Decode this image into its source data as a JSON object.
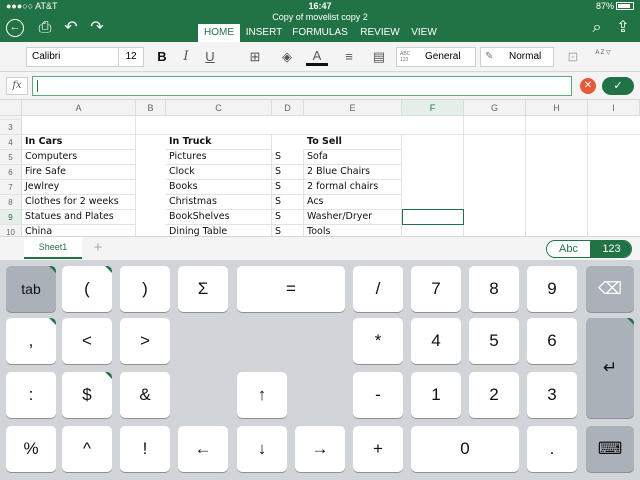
{
  "status": {
    "carrier": "●●●○○ AT&T",
    "time": "16:47",
    "battery": "87%"
  },
  "title": "Copy of movelist copy 2",
  "ribbon_tabs": [
    "HOME",
    "INSERT",
    "FORMULAS",
    "REVIEW",
    "VIEW"
  ],
  "toolbar": {
    "font": "Calibri",
    "size": "12",
    "bold": "B",
    "italic": "I",
    "underline": "U",
    "number_format": "General",
    "cell_style": "Normal",
    "number_format_icon": "ABC 123",
    "sort_icon": "A Z"
  },
  "formula": {
    "fx": "fx",
    "value": ""
  },
  "columns": [
    "A",
    "B",
    "C",
    "D",
    "E",
    "F",
    "G",
    "H",
    "I"
  ],
  "rows": [
    {
      "num": "3",
      "cells": [
        "",
        "",
        "",
        "",
        ""
      ]
    },
    {
      "num": "4",
      "cells": [
        "In Cars",
        "In Truck",
        "",
        "To Sell",
        ""
      ]
    },
    {
      "num": "5",
      "cells": [
        "Computers",
        "Pictures",
        "S",
        "Sofa",
        ""
      ]
    },
    {
      "num": "6",
      "cells": [
        "Fire Safe",
        "Clock",
        "S",
        "2 Blue Chairs",
        ""
      ]
    },
    {
      "num": "7",
      "cells": [
        "Jewlrey",
        "Books",
        "S",
        "2 formal chairs",
        ""
      ]
    },
    {
      "num": "8",
      "cells": [
        "Clothes for 2 weeks",
        "Christmas",
        "S",
        "Acs",
        ""
      ]
    },
    {
      "num": "9",
      "cells": [
        "Statues and Plates",
        "BookShelves",
        "S",
        "Washer/Dryer",
        ""
      ]
    },
    {
      "num": "10",
      "cells": [
        "China",
        "Dining Table",
        "S",
        "Tools",
        ""
      ]
    }
  ],
  "sheets": [
    "Sheet1"
  ],
  "keyboard_modes": {
    "abc": "Abc",
    "num": "123"
  },
  "keys": {
    "row1": [
      "tab",
      "(",
      ")",
      "Σ",
      "=",
      "/",
      "7",
      "8",
      "9",
      "⌫"
    ],
    "row2": [
      ",",
      "<",
      ">",
      "*",
      "4",
      "5",
      "6",
      "↵"
    ],
    "row3": [
      ":",
      "$",
      "&",
      "↑",
      "-",
      "1",
      "2",
      "3"
    ],
    "row4": [
      "%",
      "^",
      "!",
      "←",
      "↓",
      "→",
      "+",
      "0",
      ".",
      "⌨"
    ]
  },
  "accent_color": "#217346"
}
